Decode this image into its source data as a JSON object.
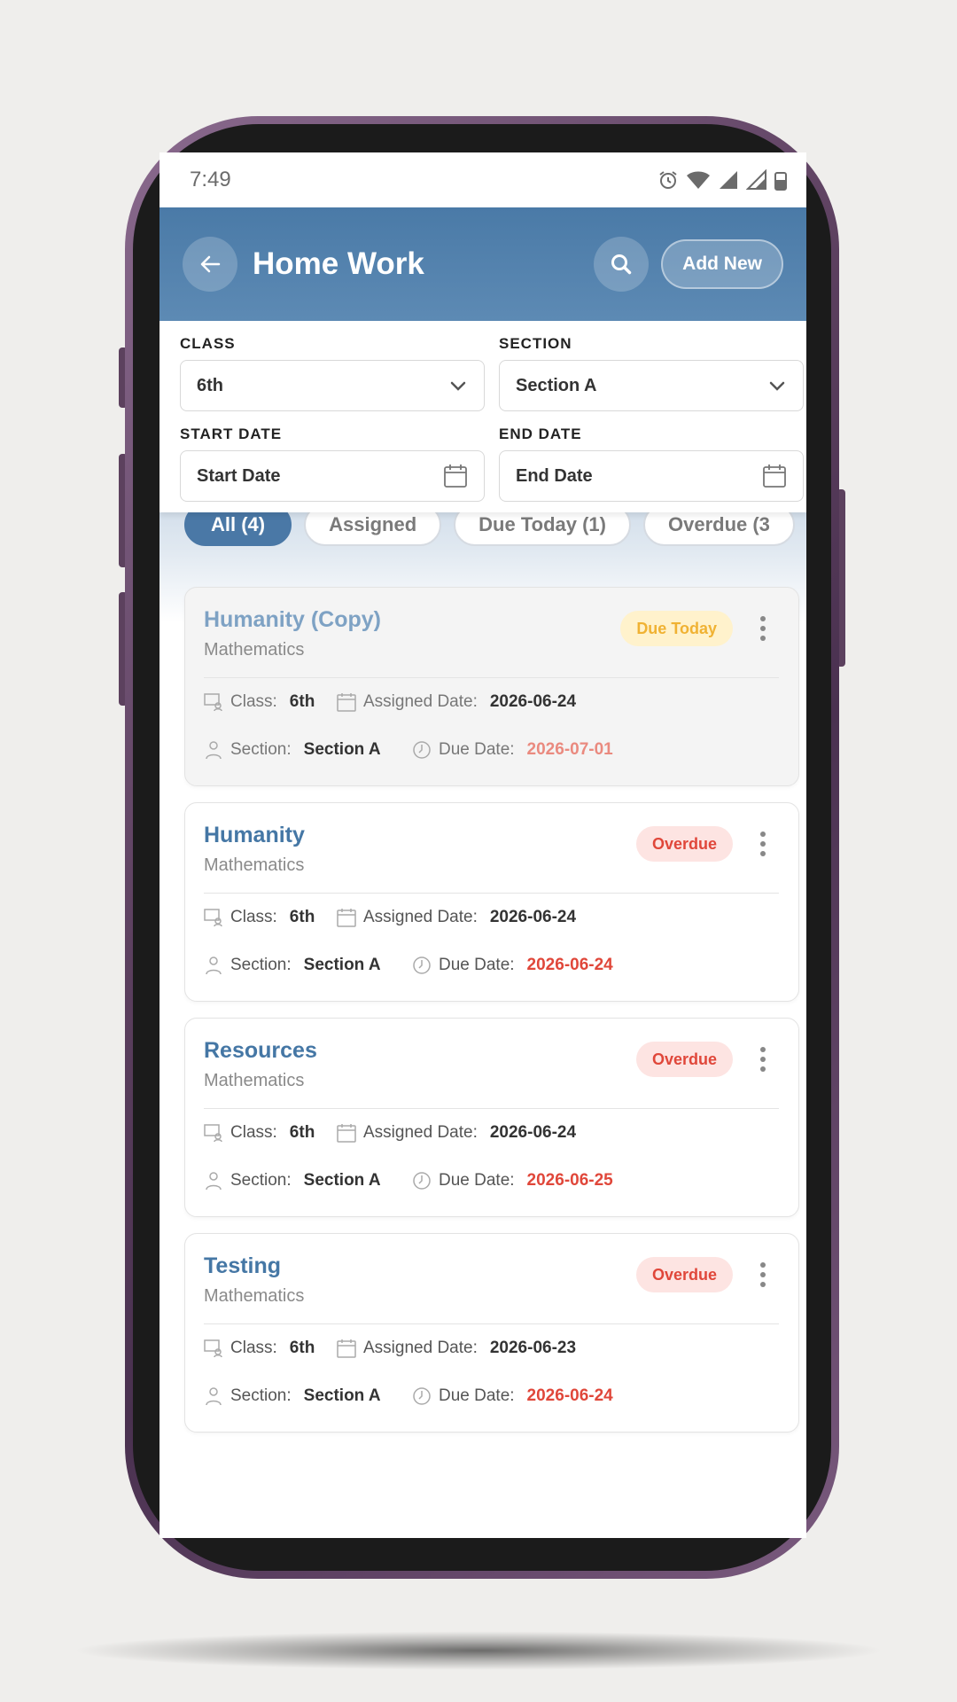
{
  "status_bar": {
    "time": "7:49"
  },
  "header": {
    "title": "Home Work",
    "add_new_label": "Add New"
  },
  "filters": {
    "class_label": "CLASS",
    "class_value": "6th",
    "section_label": "SECTION",
    "section_value": "Section A",
    "start_label": "START DATE",
    "start_placeholder": "Start Date",
    "end_label": "END DATE",
    "end_placeholder": "End Date"
  },
  "tabs": [
    {
      "label": "All (4)"
    },
    {
      "label": "Assigned"
    },
    {
      "label": "Due Today (1)"
    },
    {
      "label": "Overdue (3"
    }
  ],
  "labels": {
    "class": "Class:",
    "assigned": "Assigned Date:",
    "section": "Section:",
    "due": "Due Date:"
  },
  "cards": [
    {
      "title": "Humanity (Copy)",
      "subject": "Mathematics",
      "badge": "Due Today",
      "class": "6th",
      "assigned": "2026-06-24",
      "section": "Section A",
      "due": "2026-07-01"
    },
    {
      "title": "Humanity",
      "subject": "Mathematics",
      "badge": "Overdue",
      "class": "6th",
      "assigned": "2026-06-24",
      "section": "Section A",
      "due": "2026-06-24"
    },
    {
      "title": "Resources",
      "subject": "Mathematics",
      "badge": "Overdue",
      "class": "6th",
      "assigned": "2026-06-24",
      "section": "Section A",
      "due": "2026-06-25"
    },
    {
      "title": "Testing",
      "subject": "Mathematics",
      "badge": "Overdue",
      "class": "6th",
      "assigned": "2026-06-23",
      "section": "Section A",
      "due": "2026-06-24"
    }
  ],
  "colors": {
    "primary": "#4a78a6",
    "overdue": "#e0473a",
    "due_today": "#f0b233"
  }
}
